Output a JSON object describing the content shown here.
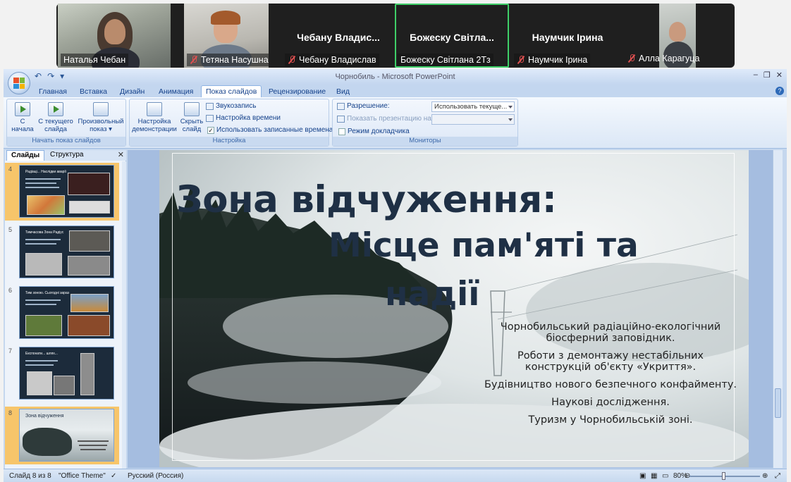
{
  "participants": [
    {
      "name": "Наталья Чебан",
      "muted": false,
      "video": true
    },
    {
      "name": "Тетяна Насушна",
      "muted": true,
      "video": true
    },
    {
      "name": "Чебану Владислав",
      "display_name": "Чебану Владис...",
      "muted": true,
      "video": false
    },
    {
      "name": "Божеску Світлана 2Тз",
      "display_name": "Божеску Світла...",
      "muted": false,
      "video": false,
      "active_speaker": true
    },
    {
      "name": "Наумчик Ірина",
      "display_name": "Наумчик Ірина",
      "muted": true,
      "video": false
    },
    {
      "name": "Алла Карагуца",
      "muted": true,
      "video": true
    }
  ],
  "window": {
    "title": "Чорнобиль - Microsoft PowerPoint",
    "qat": [
      "↶",
      "↷",
      "▾"
    ],
    "controls": [
      "‒",
      "❐",
      "✕"
    ]
  },
  "ribbon_tabs": [
    "Главная",
    "Вставка",
    "Дизайн",
    "Анимация",
    "Показ слайдов",
    "Рецензирование",
    "Вид"
  ],
  "active_tab": "Показ слайдов",
  "ribbon": {
    "start_group": {
      "label": "Начать показ слайдов",
      "from_start": [
        "С",
        "начала"
      ],
      "from_current": [
        "С текущего",
        "слайда"
      ],
      "custom_show": [
        "Произвольный",
        "показ ▾"
      ]
    },
    "setup_group": {
      "label": "Настройка",
      "setup_show": [
        "Настройка",
        "демонстрации"
      ],
      "hide_slide": [
        "Скрыть",
        "слайд"
      ],
      "record_narration": "Звукозапись",
      "rehearse_timings": "Настройка времени",
      "use_timings": "Использовать записанные времена",
      "use_timings_checked": true
    },
    "monitors_group": {
      "label": "Мониторы",
      "resolution_label": "Разрешение:",
      "resolution_value": "Использовать текуще...",
      "show_on_label": "Показать презентацию на:",
      "show_on_value": "",
      "presenter_view": "Режим докладчика",
      "presenter_view_checked": false
    }
  },
  "panel": {
    "tabs": [
      "Слайды",
      "Структура"
    ],
    "close": "✕",
    "thumbnails": [
      {
        "number": "4",
        "title": "Радіаці... Наслідки аварії",
        "selected": true
      },
      {
        "number": "5",
        "title": "Тимчасова Зона Радіус",
        "selected": false
      },
      {
        "number": "6",
        "title": "Тим зоною. Сьогодні зараз",
        "selected": false
      },
      {
        "number": "7",
        "title": "Експонати... шлях...",
        "selected": false
      },
      {
        "number": "8",
        "title": "Зона відчуження",
        "selected": true
      }
    ]
  },
  "slide": {
    "title_line1": "Зона відчуження:",
    "title_line2": "Місце пам'яті та",
    "title_line3": "надії",
    "bullets": [
      "Чорнобильський радіаційно-екологічний біосферний заповідник.",
      "Роботи з демонтажу нестабільних конструкцій об'єкту «Укриття».",
      "Будівництво нового безпечного конфайменту.",
      "Наукові дослідження.",
      "Туризм у Чорнобильській зоні."
    ]
  },
  "status": {
    "slide_counter": "Слайд 8 из 8",
    "theme": "\"Office Theme\"",
    "language": "Русский (Россия)",
    "zoom": "80%"
  },
  "colors": {
    "accent_green": "#3ecf68",
    "ribbon_text": "#15428b",
    "slide_title": "#1f3045",
    "muted_red": "#e05050"
  }
}
